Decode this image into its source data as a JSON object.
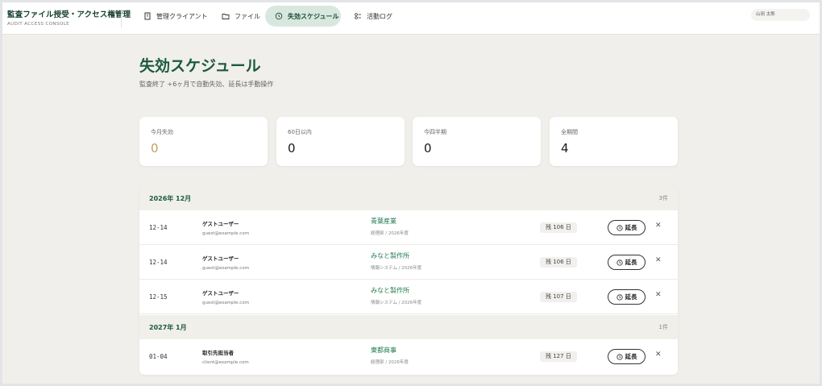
{
  "app": {
    "title": "監査ファイル授受・アクセス権管理",
    "subtitle": "AUDIT ACCESS CONSOLE"
  },
  "nav": [
    {
      "label": "管理クライアント",
      "icon": "building-icon",
      "active": false
    },
    {
      "label": "ファイル",
      "icon": "folder-icon",
      "active": false
    },
    {
      "label": "失効スケジュール",
      "icon": "clock-icon",
      "active": true
    },
    {
      "label": "活動ログ",
      "icon": "activity-icon",
      "active": false
    }
  ],
  "user": {
    "name": "山田 太郎"
  },
  "page": {
    "title": "失効スケジュール",
    "subtitle": "監査終了 +6ヶ月で自動失効、延長は手動操作"
  },
  "stats": [
    {
      "label": "今月失効",
      "value": "0",
      "accent": "#c2a15a"
    },
    {
      "label": "60日以内",
      "value": "0"
    },
    {
      "label": "今四半期",
      "value": "0"
    },
    {
      "label": "全期間",
      "value": "4"
    }
  ],
  "extend_label": "延長",
  "groups": [
    {
      "title": "2026年 12月",
      "count": "3件",
      "rows": [
        {
          "date": "12-14",
          "name": "ゲストユーザー",
          "email": "guest@example.com",
          "client": "青葉産業",
          "meta": "経理部 / 2026年度",
          "remaining": "残 106 日"
        },
        {
          "date": "12-14",
          "name": "ゲストユーザー",
          "email": "guest@example.com",
          "client": "みなと製作所",
          "meta": "情報システム / 2026年度",
          "remaining": "残 106 日"
        },
        {
          "date": "12-15",
          "name": "ゲストユーザー",
          "email": "guest@example.com",
          "client": "みなと製作所",
          "meta": "情報システム / 2026年度",
          "remaining": "残 107 日"
        }
      ]
    },
    {
      "title": "2027年 1月",
      "count": "1件",
      "rows": [
        {
          "date": "01-04",
          "name": "取引先担当者",
          "email": "client@example.com",
          "client": "東都商事",
          "meta": "経理部 / 2026年度",
          "remaining": "残 127 日"
        }
      ]
    }
  ],
  "colors": {
    "brand": "#143d2e",
    "accent_green": "#1d7a4c",
    "active_nav": "#d8e8df",
    "warn": "#c2a15a"
  }
}
